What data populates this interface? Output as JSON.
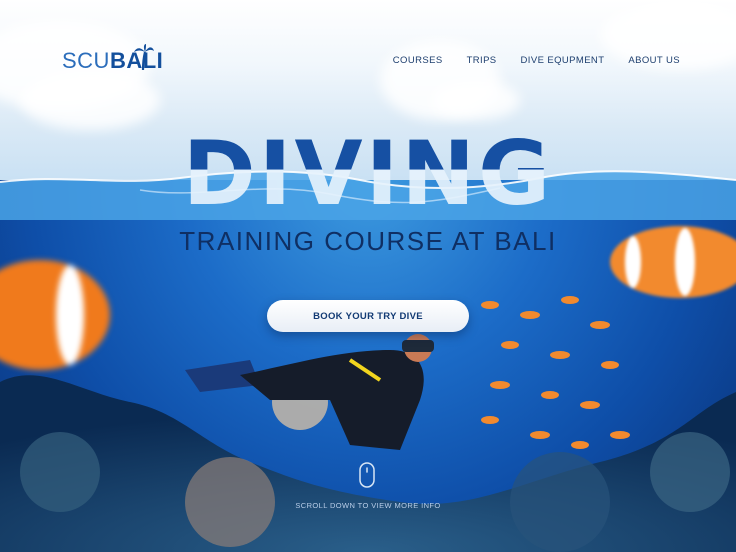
{
  "brand": {
    "logo_thin": "SCU",
    "logo_bold": "BALI"
  },
  "nav": {
    "items": [
      {
        "label": "COURSES"
      },
      {
        "label": "TRIPS"
      },
      {
        "label": "DIVE EQUPMENT"
      },
      {
        "label": "ABOUT US"
      }
    ]
  },
  "hero": {
    "title": "DIVING",
    "subtitle": "TRAINING COURSE AT BALI",
    "cta_label": "BOOK YOUR TRY DIVE"
  },
  "scroll_hint": {
    "text": "SCROLL DOWN TO VIEW MORE INFO"
  },
  "colors": {
    "brand_blue": "#134f9c",
    "sky": "#f1f7fc",
    "water": "#1c6cc8",
    "fish_orange": "#f28a2e"
  }
}
